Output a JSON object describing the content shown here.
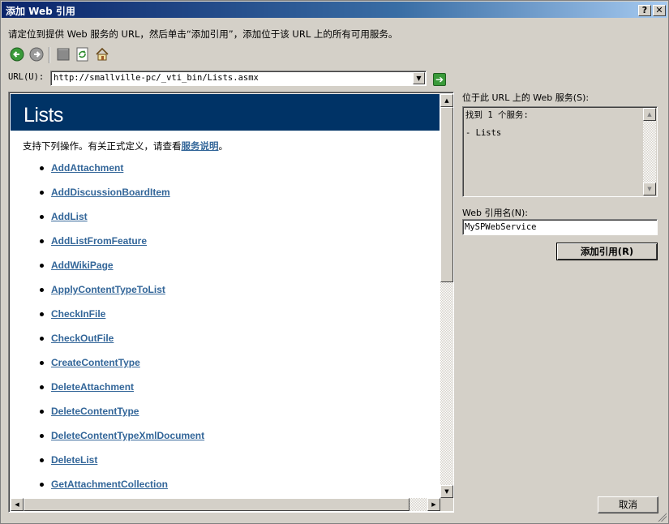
{
  "window": {
    "title": "添加 Web 引用",
    "help_label": "?",
    "close_label": "✕"
  },
  "instructions": "请定位到提供 Web 服务的 URL，然后单击“添加引用”，添加位于该 URL 上的所有可用服务。",
  "toolbar": {
    "icons": [
      "back-icon",
      "forward-icon",
      "stop-icon",
      "refresh-icon",
      "home-icon"
    ]
  },
  "url": {
    "label": "URL(U):",
    "value": "http://smallville-pc/_vti_bin/Lists.asmx",
    "go_label": "➔"
  },
  "browser": {
    "title": "Lists",
    "intro_text": "支持下列操作。有关正式定义，请查看",
    "intro_link": "服务说明",
    "intro_end": "。",
    "operations": [
      "AddAttachment",
      "AddDiscussionBoardItem",
      "AddList",
      "AddListFromFeature",
      "AddWikiPage",
      "ApplyContentTypeToList",
      "CheckInFile",
      "CheckOutFile",
      "CreateContentType",
      "DeleteAttachment",
      "DeleteContentType",
      "DeleteContentTypeXmlDocument",
      "DeleteList",
      "GetAttachmentCollection"
    ]
  },
  "services": {
    "label": "位于此 URL 上的 Web 服务(S):",
    "found": "找到 1 个服务:",
    "items": [
      "- Lists"
    ]
  },
  "reference": {
    "label": "Web 引用名(N):",
    "value": "MySPWebService"
  },
  "buttons": {
    "add": "添加引用(R)",
    "cancel": "取消"
  },
  "colors": {
    "title_bar": "#0a246a",
    "header_band": "#003366",
    "link": "#336699",
    "face": "#d4d0c8"
  }
}
